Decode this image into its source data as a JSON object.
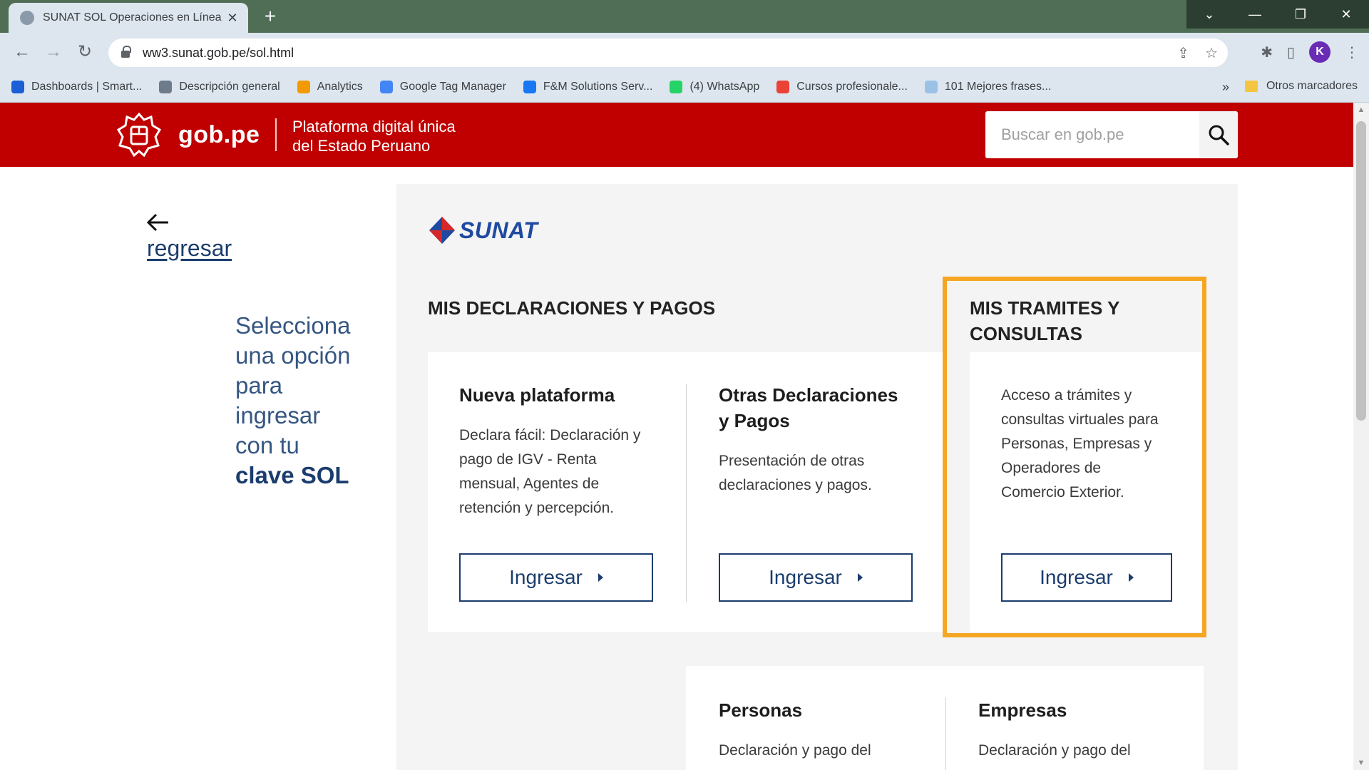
{
  "browser": {
    "tab_title": "SUNAT SOL Operaciones en Línea",
    "tab_close": "✕",
    "new_tab": "+",
    "window_buttons": [
      "⌄",
      "—",
      "❐",
      "✕"
    ],
    "url": "ww3.sunat.gob.pe/sol.html",
    "avatar_letter": "K",
    "bookmarks": [
      {
        "label": "Dashboards | Smart...",
        "color": "#1a5fd6"
      },
      {
        "label": "Descripción general",
        "color": "#6d7b8a"
      },
      {
        "label": "Analytics",
        "color": "#f29900"
      },
      {
        "label": "Google Tag Manager",
        "color": "#4285f4"
      },
      {
        "label": "F&M Solutions Serv...",
        "color": "#1877f2"
      },
      {
        "label": "(4) WhatsApp",
        "color": "#25d366"
      },
      {
        "label": "Cursos profesionale...",
        "color": "#ea4335"
      },
      {
        "label": "101 Mejores frases...",
        "color": "#9bc2e6"
      }
    ],
    "bookmarks_more": "»",
    "other_bookmarks": "Otros marcadores"
  },
  "header": {
    "brand": "gob.pe",
    "tagline_1": "Plataforma digital única",
    "tagline_2": "del Estado Peruano",
    "search_placeholder": "Buscar en gob.pe",
    "brand_color": "#c00000"
  },
  "sidebar": {
    "back_label": "regresar",
    "intro_lines": [
      "Selecciona",
      "una opción",
      "para",
      "ingresar",
      "con tu"
    ],
    "intro_strong": "clave SOL"
  },
  "main": {
    "logo_text": "SUNAT",
    "section_decl": "MIS DECLARACIONES Y PAGOS",
    "section_tram_1": "MIS TRAMITES Y",
    "section_tram_2": "CONSULTAS",
    "cards": [
      {
        "title_1": "Nueva plataforma",
        "title_2": "",
        "desc": [
          "Declara fácil: Declaración y",
          "pago de IGV - Renta",
          "mensual, Agentes de",
          "retención y percepción."
        ],
        "button": "Ingresar"
      },
      {
        "title_1": "Otras Declaraciones",
        "title_2": "y Pagos",
        "desc": [
          "Presentación de otras",
          "declaraciones y pagos."
        ],
        "button": "Ingresar"
      },
      {
        "title_1": "",
        "title_2": "",
        "desc": [
          "Acceso a trámites y",
          "consultas virtuales para",
          "Personas, Empresas y",
          "Operadores de",
          "Comercio Exterior."
        ],
        "button": "Ingresar"
      }
    ],
    "bottom_cards": [
      {
        "title": "Personas",
        "desc": "Declaración y pago del"
      },
      {
        "title": "Empresas",
        "desc": "Declaración y pago del"
      }
    ],
    "highlight_color": "#f5a623"
  }
}
